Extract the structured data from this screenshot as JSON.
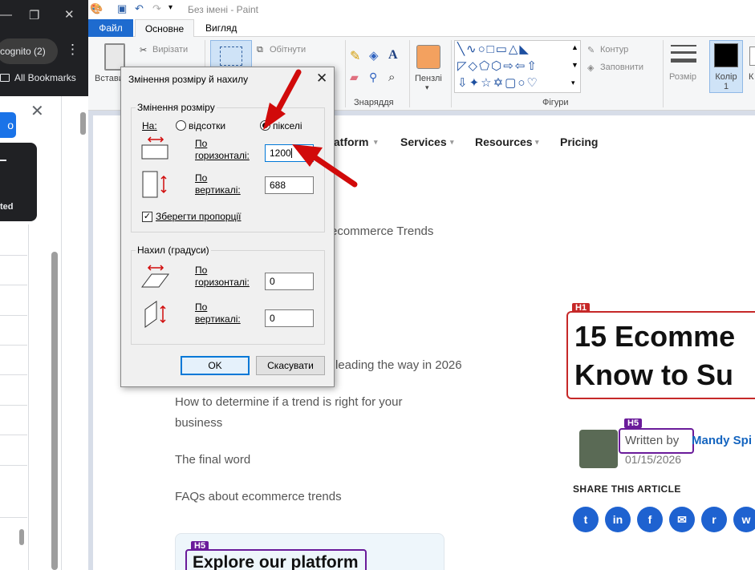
{
  "chrome": {
    "incognito_label": "cognito (2)",
    "bookmarks_label": "All Bookmarks",
    "popup_text": "ted",
    "blue_btn": "o"
  },
  "paint": {
    "window_title": "Без імені - Paint",
    "tabs": {
      "file": "Файл",
      "home": "Основне",
      "view": "Вигляд"
    },
    "ribbon": {
      "paste": "Встави",
      "cut": "Вирізати",
      "crop": "Обітнути",
      "tools_group": "Знаряддя",
      "brushes": "Пензлі",
      "shapes_group": "Фігури",
      "outline": "Контур",
      "fill": "Заповнити",
      "size": "Розмір",
      "color1": "Колір 1",
      "color2_partial": "К"
    }
  },
  "webpage": {
    "nav": [
      "latform",
      "Services",
      "Resources",
      "Pricing"
    ],
    "toc": [
      "ecommerce Trends",
      "leading the way in 2026",
      "How to determine if a trend is right for your",
      "business",
      "The final word",
      "FAQs about ecommerce trends"
    ],
    "h1_tag": "H1",
    "h1_line1": "15 Ecomme",
    "h1_line2": "Know to Su",
    "h5_tag": "H5",
    "written_by": "Written by",
    "author": "Mandy Spi",
    "date": "01/15/2026",
    "share": "SHARE THIS ARTICLE",
    "social": [
      "t",
      "in",
      "f",
      "✉",
      "r",
      "w"
    ],
    "explore_tag": "H5",
    "explore": "Explore our platform"
  },
  "dialog": {
    "title": "Змінення розміру й нахилу",
    "resize_group": "Змінення розміру",
    "by_label": "На:",
    "percent": "відсотки",
    "pixels": "пікселі",
    "horizontal": [
      "По",
      "горизонталі:"
    ],
    "vertical": [
      "По",
      "вертикалі:"
    ],
    "resize_h_value": "1200",
    "resize_v_value": "688",
    "keep_ratio": "Зберегти пропорції",
    "skew_group": "Нахил (градуси)",
    "skew_h_value": "0",
    "skew_v_value": "0",
    "ok": "OK",
    "cancel": "Скасувати"
  },
  "colors": {
    "annotation_arrow": "#d10a0a",
    "accent": "#0078d7",
    "file_tab": "#1e6bcf"
  }
}
